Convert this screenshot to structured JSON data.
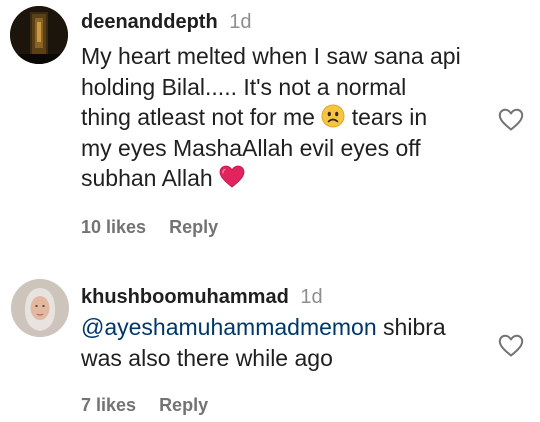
{
  "comments": [
    {
      "username": "deenanddepth",
      "time": "1d",
      "text_lines": [
        "My heart melted when I saw sana api",
        "holding Bilal..... It's not a normal",
        "thing atleast not for me",
        "tears in",
        "my eyes MashaAllah evil eyes off",
        "subhan Allah"
      ],
      "likes_label": "10 likes",
      "reply_label": "Reply"
    },
    {
      "username": "khushboomuhammad",
      "time": "1d",
      "mention": "@ayeshamuhammadmemon",
      "text_after_mention": " shibra",
      "text_line2": "was also there while ago",
      "likes_label": "7 likes",
      "reply_label": "Reply"
    }
  ],
  "icons": {
    "like": "heart-outline-icon",
    "sad_emoji": "slightly-frowning-face-emoji",
    "heart_emoji": "red-heart-emoji"
  },
  "colors": {
    "text": "#262626",
    "secondary": "#8e8e8e",
    "mention": "#00376b",
    "heart_red": "#e0245e"
  }
}
